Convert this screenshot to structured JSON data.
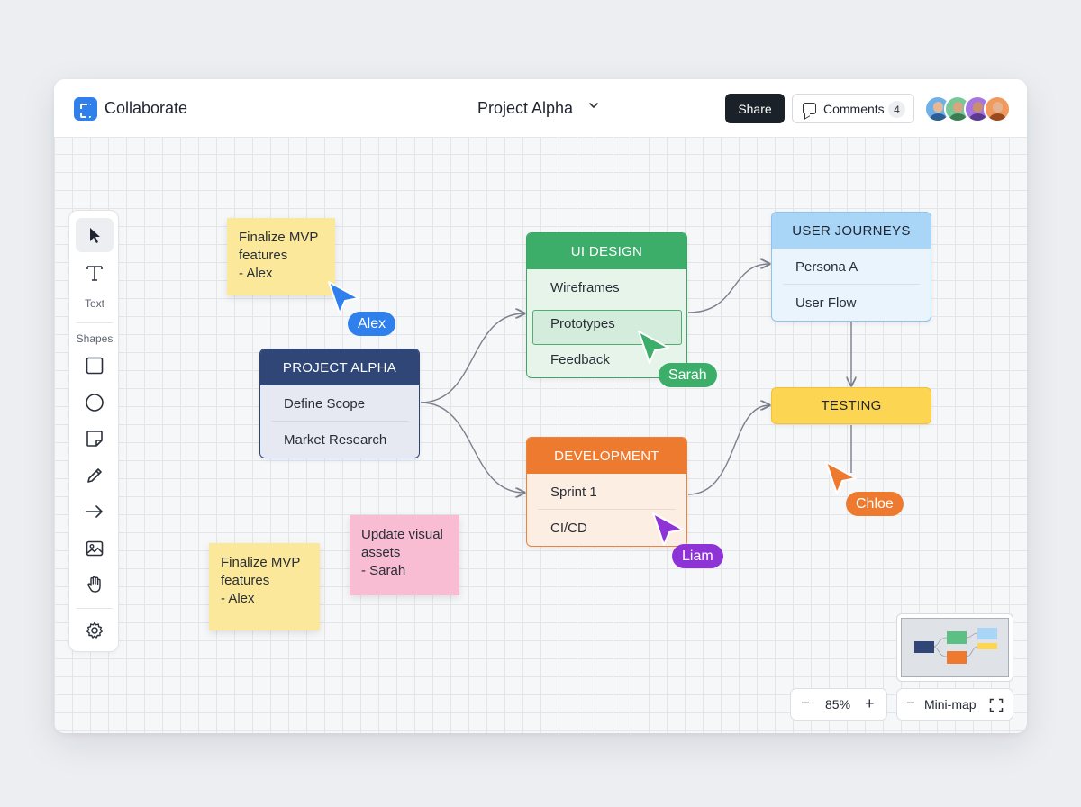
{
  "app": {
    "name": "Collaborate",
    "brand_color": "#2f80ed"
  },
  "header": {
    "project_title": "Project Alpha",
    "share_label": "Share",
    "comments_label": "Comments",
    "comments_count": "4",
    "avatars": [
      {
        "name": "user-1",
        "ring_color": "#4a90d9"
      },
      {
        "name": "user-2",
        "ring_color": "#3cae6a"
      },
      {
        "name": "user-3",
        "ring_color": "#8e44d6"
      },
      {
        "name": "user-4",
        "ring_color": "#ee7a2f"
      }
    ]
  },
  "toolbar": {
    "text_label": "Text",
    "shapes_label": "Shapes",
    "tools": [
      "select-icon",
      "text-icon",
      "rectangle-icon",
      "circle-icon",
      "sticky-note-icon",
      "pencil-icon",
      "arrow-icon",
      "image-icon",
      "hand-icon",
      "settings-icon"
    ]
  },
  "stickies": [
    {
      "text": "Finalize MVP\nfeatures\n- Alex",
      "color": "#fbe89a"
    },
    {
      "text": "Finalize MVP\nfeatures\n- Alex",
      "color": "#fbe89a"
    },
    {
      "text": "Update visual\nassets\n- Sarah",
      "color": "#f8bcd3"
    }
  ],
  "nodes": {
    "project_alpha": {
      "title": "PROJECT ALPHA",
      "items": [
        "Define Scope",
        "Market Research"
      ]
    },
    "ui_design": {
      "title": "UI DESIGN",
      "items": [
        "Wireframes",
        "Prototypes",
        "Feedback"
      ],
      "selected": "Prototypes"
    },
    "development": {
      "title": "DEVELOPMENT",
      "items": [
        "Sprint 1",
        "CI/CD"
      ]
    },
    "user_journeys": {
      "title": "USER JOURNEYS",
      "items": [
        "Persona A",
        "User Flow"
      ]
    },
    "testing": {
      "title": "TESTING"
    }
  },
  "cursors": [
    {
      "name": "Alex",
      "color": "#2f80ed"
    },
    {
      "name": "Sarah",
      "color": "#3cae6a"
    },
    {
      "name": "Liam",
      "color": "#8e34d6"
    },
    {
      "name": "Chloe",
      "color": "#ee7a2f"
    }
  ],
  "zoom": {
    "level": "85%",
    "minus": "−",
    "plus": "+"
  },
  "minimap": {
    "label": "Mini-map",
    "collapse": "−"
  }
}
